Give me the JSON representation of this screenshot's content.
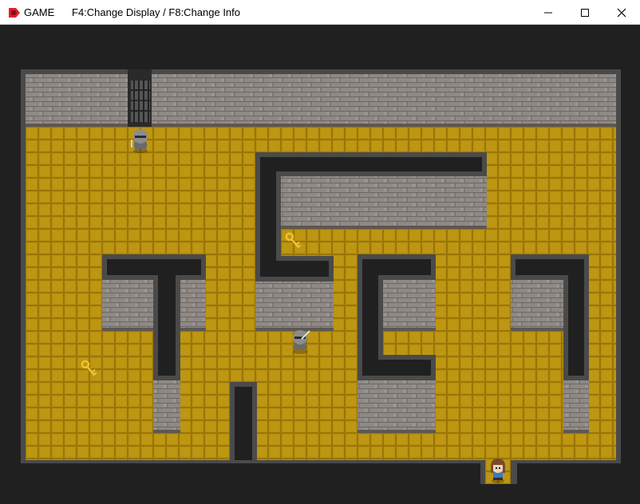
{
  "window": {
    "app_name": "GAME",
    "title": "F4:Change Display / F8:Change Info",
    "icons": {
      "app": "rpg-maker-icon",
      "minimize": "minimize-icon",
      "maximize": "maximize-icon",
      "close": "close-icon"
    }
  },
  "game": {
    "scene": "top-down dungeon maze",
    "colors": {
      "void": "#202020",
      "wall_face": "#8f8985",
      "wall_edge": "#4a4a4a",
      "floor": "#b8900f",
      "floor_line": "#9a7608"
    },
    "entities": [
      {
        "kind": "knight",
        "name": "armored-guard",
        "weapon": "sword"
      },
      {
        "kind": "knight",
        "name": "armored-guard",
        "weapon": "sword"
      },
      {
        "kind": "key",
        "name": "golden-key"
      },
      {
        "kind": "key",
        "name": "golden-key"
      },
      {
        "kind": "player",
        "name": "girl-hero"
      }
    ],
    "features": [
      "iron-bars-gate",
      "exit-doorway"
    ]
  }
}
